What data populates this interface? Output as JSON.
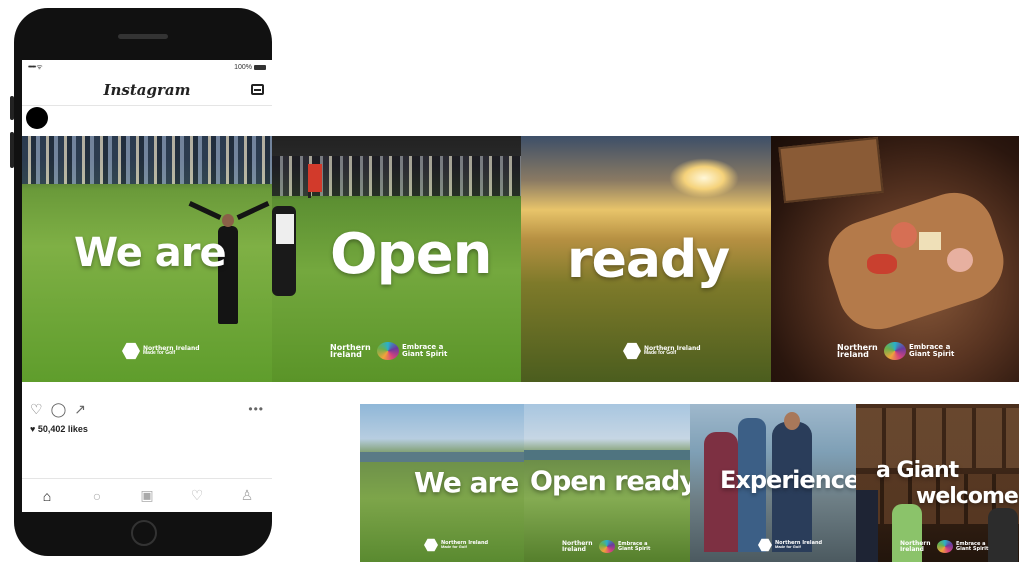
{
  "phone": {
    "status_left": "••••• ᯤ",
    "status_right": "100%",
    "app_title": "Instagram",
    "likes": "♥ 50,402 likes",
    "icons": {
      "inbox": "inbox-icon",
      "like": "heart-outline-icon",
      "comment": "comment-icon",
      "share": "share-icon",
      "more": "more-dots-icon",
      "home": "home-icon",
      "search": "search-icon",
      "camera": "camera-icon",
      "activity": "heart-icon",
      "profile": "profile-icon"
    }
  },
  "top_strip": {
    "panel1_word": "We are",
    "panel2_word": "Open",
    "panel3_word": "ready",
    "badge_small_1": "Northern Ireland",
    "badge_small_2": "Made for Golf",
    "brand_1": "Northern Ireland",
    "brand_2": "Embrace a Giant Spirit"
  },
  "bottom_strip": {
    "panel1_word": "We are",
    "panel2_word": "Open ready",
    "panel3_word": "Experience",
    "panel4_word_a": "a Giant",
    "panel4_word_b": "welcome"
  },
  "colors": {
    "grass": "#5f9d2c",
    "sky_gold": "#d6a247",
    "dark_food": "#3a2318",
    "accent_swirl": "#6c3a9c"
  }
}
